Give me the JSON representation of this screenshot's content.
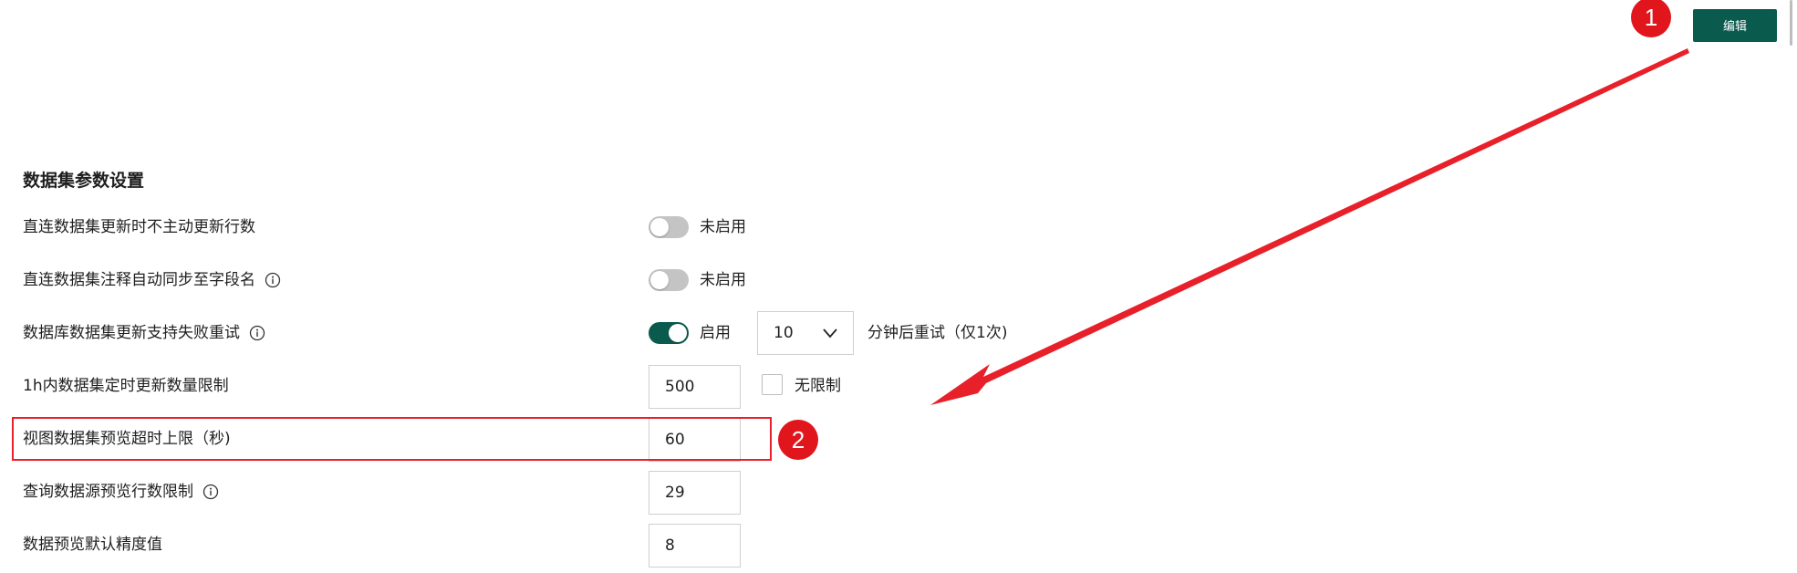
{
  "toolbar": {
    "edit_label": "编辑"
  },
  "annotations": {
    "step1": "1",
    "step2": "2",
    "highlight_color": "#e8202a"
  },
  "section": {
    "title": "数据集参数设置"
  },
  "settings": [
    {
      "label": "直连数据集更新时不主动更新行数",
      "has_info": false,
      "toggle_state": "off",
      "toggle_text": "未启用"
    },
    {
      "label": "直连数据集注释自动同步至字段名",
      "has_info": true,
      "toggle_state": "off",
      "toggle_text": "未启用"
    },
    {
      "label": "数据库数据集更新支持失败重试",
      "has_info": true,
      "toggle_state": "on",
      "toggle_text": "启用",
      "retry_select_value": "10",
      "retry_suffix": "分钟后重试（仅1次)"
    },
    {
      "label": "1h内数据集定时更新数量限制",
      "has_info": false,
      "input_value": "500",
      "checkbox_label": "无限制",
      "checkbox_checked": false
    },
    {
      "label": "视图数据集预览超时上限（秒)",
      "has_info": false,
      "input_value": "60"
    },
    {
      "label": "查询数据源预览行数限制",
      "has_info": true,
      "input_value": "29"
    },
    {
      "label": "数据预览默认精度值",
      "has_info": false,
      "input_value": "8"
    }
  ],
  "colors": {
    "primary": "#0b5a4e",
    "toggle_off": "#c4c4c4",
    "annotation_red": "#e0161c"
  }
}
